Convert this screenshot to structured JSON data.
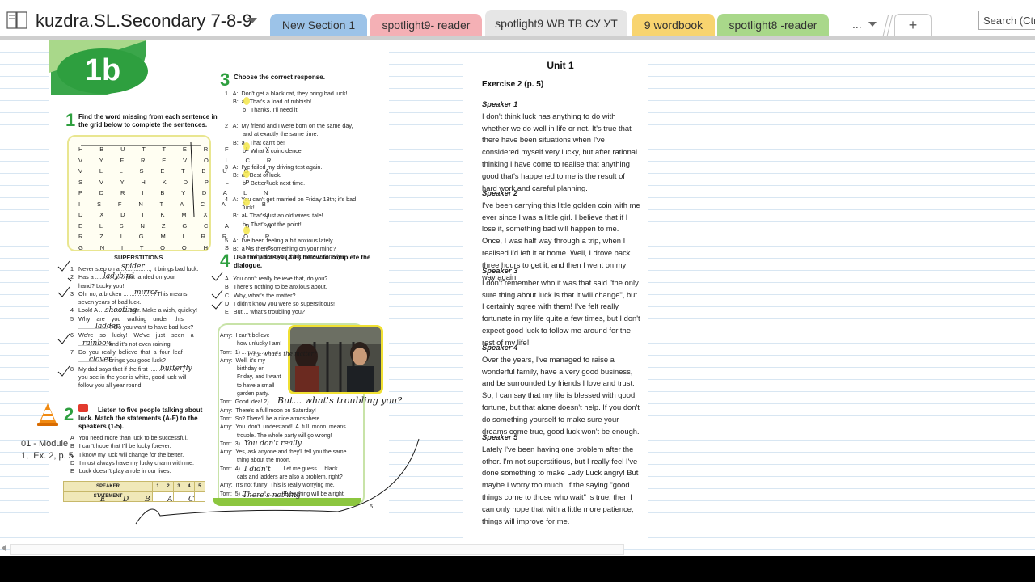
{
  "notebook": {
    "title": "kuzdra.SL.Secondary 7-8-9"
  },
  "tabs": [
    {
      "label": "New Section 1",
      "color": "#9cc3e8"
    },
    {
      "label": "spotlight9- reader",
      "color": "#f4b0b5"
    },
    {
      "label": "spotlight9 WB TB СУ УТ",
      "color": "#e6e6e6"
    },
    {
      "label": "9 wordbook",
      "color": "#f8d46f"
    },
    {
      "label": "spotlight8 -reader",
      "color": "#a9d88a"
    }
  ],
  "tab_more": "...",
  "tab_add": "+",
  "search": {
    "placeholder": "Search (Ctrl"
  },
  "colors": {
    "accent_green": "#2e9f3f",
    "highlight": "#f3e64a",
    "rule_line": "#d8e6f2",
    "margin_line": "#e39a9a"
  },
  "workbook": {
    "badge": "1b",
    "ex1": {
      "num": "1",
      "heading": "Find the word missing from each sentence in\nthe grid below to complete the sentences.",
      "grid": [
        "H B U T T E R F L Y",
        "V Y F R E V O L C R",
        "V L L S E T B U G A",
        "S V Y H K D P L P I",
        "P D R I B Y D A L N",
        "I S F N T A C A J B",
        "D X D I K M X T L O",
        "E L S N Z G C A B W",
        "R Z I G M I R R O R",
        "G N I T O O H S N S"
      ],
      "superstitions_title": "SUPERSTITIONS",
      "sentences": "1   Never step on a ..................; it brings bad luck.\n2   Has a .................. just landed on your\n     hand? Lucky you!\n3   Oh, no, a broken .................. ! This means\n     seven years of bad luck.\n4   Look! A .................. star. Make a wish, quickly!\n5   Why    are    you    walking    under    this\n     .................. ? Do you want to have bad luck?\n6   We're    so    lucky!    We've    just    seen    a\n     .................. and it's not even raining!\n7   Do  you  really  believe  that  a  four  leaf\n     .................. brings you good luck?\n8   My dad says that if the first ..................\n     you see in the year is white, good luck will\n     follow you all year round."
    },
    "ex2": {
      "num": "2",
      "heading": "Listen to five people talking about\nluck. Match the statements (A-E) to the\nspeakers (1-5).",
      "statements": "A   You need more than luck to be successful.\nB   I can't hope that I'll be lucky forever.\nC   I know my luck will change for the better.\nD   I must always have my lucky charm with me.\nE   Luck doesn't play a role in our lives.",
      "table_head": [
        "SPEAKER",
        "1",
        "2",
        "3",
        "4",
        "5"
      ],
      "table_row_label": "STATEMENT",
      "side_label": "01 - Module\n1,  Ex. 2, p. 5"
    },
    "ex3": {
      "num": "3",
      "heading": "Choose the correct response.",
      "text": "1   A:  Don't get a black cat, they bring bad luck!\n     B:  a   That's a load of rubbish!\n           b   Thanks, I'll need it!\n\n2   A:  My friend and I were born on the same day,\n           and at exactly the same time.\n     B:  a   That can't be!\n           b   What a coincidence!\n\n3   A:  I've failed my driving test again.\n     B:  a   Best of luck.\n           b   Better luck next time.\n\n4   A:  You can't get married on Friday 13th; it's bad\n           luck!\n     B:  a   That's just an old wives' tale!\n           b   That's not the point!\n\n5   A:  I've been feeling a bit anxious lately.\n     B:  a   Is there something on your mind?\n           b   Why don't you think more rationally?"
    },
    "ex4": {
      "num": "4",
      "heading": "Use the phrases (A-E) below to complete the\ndialogue.",
      "phrases": "A   You don't really believe that, do you?\nB   There's nothing to be anxious about.\nC   Why, what's the matter?\nD   I didn't know you were so superstitious!\nE   But ... what's troubling you?",
      "dialogue": "Amy:  I can't believe\n           how unlucky I am!\nTom:  1) ..........................\nAmy:  Well, it's my\n           birthday on\n           Friday, and I want\n           to have a small\n           garden party.\nTom:  Good idea! 2) ..........................\nAmy:  There's a full moon on Saturday!\nTom:  So? There'll be a nice atmosphere.\nAmy:  You  don't  understand!  A  full  moon  means\n           trouble. The whole party will go wrong!\nTom:  3) ..........................\nAmy:  Yes, ask anyone and they'll tell you the same\n           thing about the moon.\nTom:  4) .......................... Let me guess ... black\n           cats and ladders are also a problem, right?\nAmy:  It's not funny! This is really worrying me.\nTom:  5) .......................... Everything will be alright.",
      "page_num": "5"
    },
    "handwriting": {
      "s1": "spider",
      "s2": "ladybird",
      "s3": "mirror",
      "s4": "shooting",
      "s5": "ladder",
      "s6": "rainbow",
      "s7": "clover",
      "s8": "butterfly",
      "t1": "Why, what's the matter?",
      "t2": "But... what's troubling you?",
      "t3": "You don't really",
      "t4": "I didn't",
      "t5": "There's nothing",
      "answers": [
        "E",
        "D",
        "B",
        "A",
        "C"
      ]
    }
  },
  "unit": {
    "title": "Unit 1",
    "exercise": "Exercise 2 (p. 5)",
    "speakers": [
      {
        "name": "Speaker 1",
        "text": "I don't think luck has anything to do with whether we do well in life or not. It's true that there have been situations when I've considered myself very lucky, but after rational thinking I have come to realise that anything good that's happened to me is the result of hard work and careful planning."
      },
      {
        "name": "Speaker 2",
        "text": "I've been carrying this little golden coin with me ever since I was a little girl. I believe that if I lose it, something bad will happen to me. Once, I was half way through a trip, when I realised I'd left it at home. Well, I drove back three hours to get it, and then I went on my way again!"
      },
      {
        "name": "Speaker 3",
        "text": "I don't remember who it was that said \"the only sure thing about luck is that it will change\", but I certainly agree with them! I've felt really fortunate in my life quite a few times, but I don't expect good luck to follow me around for the rest of my life!"
      },
      {
        "name": "Speaker 4",
        "text": "Over the years, I've managed to raise a wonderful family, have a very good business, and be surrounded by friends I love and trust. So, I can say that my life is blessed with good fortune, but that alone doesn't help. If you don't do something yourself to make sure your dreams come true, good luck won't be enough."
      },
      {
        "name": "Speaker 5",
        "text": "Lately I've been having one problem after the other. I'm not superstitious, but I really feel I've done something to make Lady Luck angry! But maybe I worry too much. If the saying \"good things come to those who wait\" is true, then I can only hope that with a little more patience, things will improve for me."
      }
    ]
  }
}
